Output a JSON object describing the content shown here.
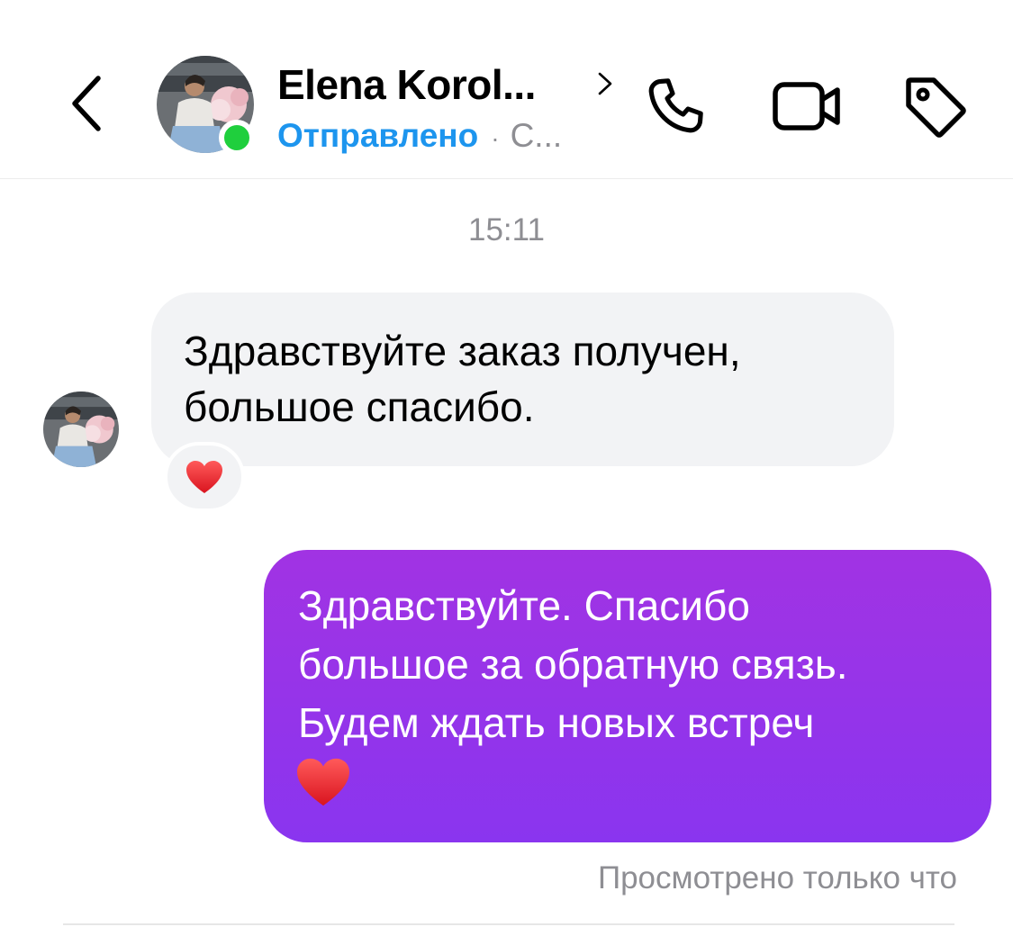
{
  "header": {
    "contact_name": "Elena Korol...",
    "status_sent": "Отправлено",
    "status_separator": "·",
    "status_extra": "С...",
    "online": true,
    "back_icon": "chevron-left-icon",
    "name_chevron_icon": "chevron-right-icon",
    "phone_icon": "phone-icon",
    "video_icon": "video-camera-icon",
    "tag_icon": "tag-icon"
  },
  "conversation": {
    "timestamp": "15:11",
    "messages": [
      {
        "direction": "incoming",
        "text_lines": [
          "Здравствуйте заказ получен,",
          "большое спасибо."
        ],
        "reaction": "❤️"
      },
      {
        "direction": "outgoing",
        "text_lines": [
          "Здравствуйте. Спасибо",
          "большое за обратную связь.",
          "Будем ждать новых встреч"
        ],
        "emoji": "❤️"
      }
    ],
    "seen_status": "Просмотрено только что"
  },
  "colors": {
    "accent_blue": "#1d95ee",
    "online_green": "#1fcf3d",
    "outgoing_bubble_top": "#a133e3",
    "outgoing_bubble_bottom": "#8a35ef",
    "incoming_bubble": "#f2f3f5",
    "muted_text": "#8e8e93"
  }
}
